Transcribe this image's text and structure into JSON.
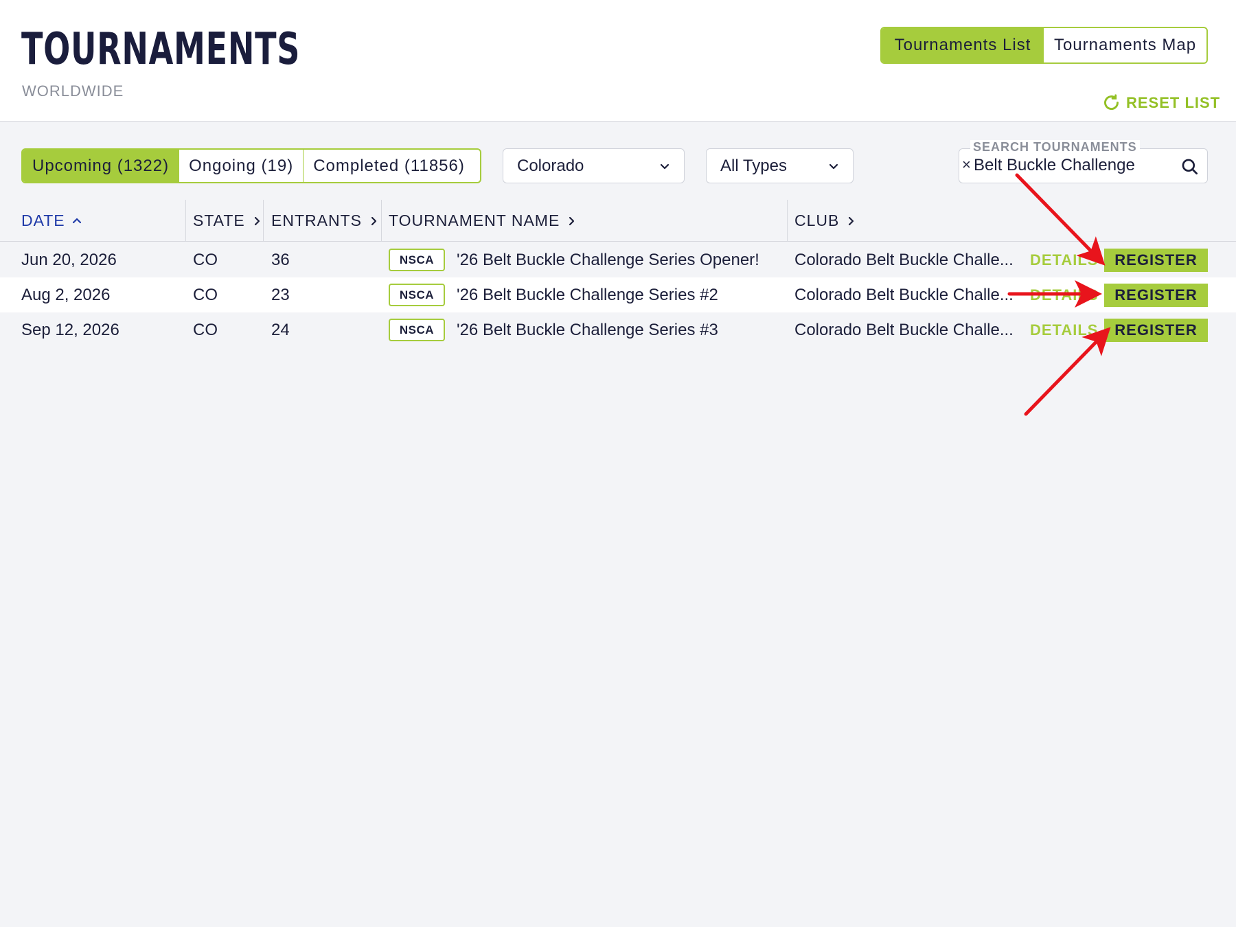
{
  "header": {
    "title": "TOURNAMENTS",
    "subtitle": "WORLDWIDE",
    "view_toggle": {
      "list_label": "Tournaments List",
      "map_label": "Tournaments Map"
    },
    "reset_label": "RESET LIST"
  },
  "filters": {
    "status_tabs": [
      {
        "label": "Upcoming (1322)"
      },
      {
        "label": "Ongoing (19)"
      },
      {
        "label": "Completed (11856)"
      }
    ],
    "state_select": "Colorado",
    "type_select": "All Types",
    "search": {
      "label": "SEARCH TOURNAMENTS",
      "value": "Belt Buckle Challenge",
      "clear_glyph": "×"
    }
  },
  "table": {
    "columns": {
      "date": "DATE",
      "state": "STATE",
      "entrants": "ENTRANTS",
      "name": "TOURNAMENT NAME",
      "club": "CLUB"
    },
    "rows": [
      {
        "date": "Jun 20, 2026",
        "state": "CO",
        "entrants": "36",
        "badge": "NSCA",
        "name": "'26 Belt Buckle Challenge Series Opener!",
        "club": "Colorado Belt Buckle Challe...",
        "details": "DETAILS",
        "register": "REGISTER"
      },
      {
        "date": "Aug 2, 2026",
        "state": "CO",
        "entrants": "23",
        "badge": "NSCA",
        "name": "'26 Belt Buckle Challenge Series #2",
        "club": "Colorado Belt Buckle Challe...",
        "details": "DETAILS",
        "register": "REGISTER"
      },
      {
        "date": "Sep 12, 2026",
        "state": "CO",
        "entrants": "24",
        "badge": "NSCA",
        "name": "'26 Belt Buckle Challenge Series #3",
        "club": "Colorado Belt Buckle Challe...",
        "details": "DETAILS",
        "register": "REGISTER"
      }
    ]
  },
  "colors": {
    "accent": "#a6cc3d",
    "text_dark": "#1c1f3a",
    "sorted_header": "#1f3aa8",
    "annotation_arrow": "#e8141c"
  },
  "icons": {
    "reset": "refresh-icon",
    "search": "search-icon",
    "select": "chevron-down-icon",
    "sort_asc": "chevron-up-icon",
    "sort": "chevron-right-icon"
  }
}
